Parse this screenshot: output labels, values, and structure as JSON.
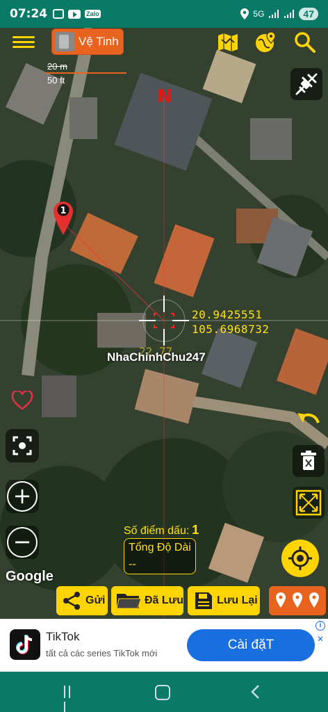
{
  "status_bar": {
    "time": "07:24",
    "zalo": "Zalo",
    "network": "5G",
    "battery": "47"
  },
  "toolbar": {
    "map_type_label": "Vệ Tinh"
  },
  "scale": {
    "meters": "20 m",
    "feet": "50 ft"
  },
  "compass_label": "N",
  "marker_label": "1",
  "coordinates": {
    "lat": "20.9425551",
    "lon": "105.6968732"
  },
  "distance_overlay": "22.77",
  "watermark": "NhaChinhChu247",
  "measure": {
    "count_label": "Số điểm dấu:",
    "count_value": "1",
    "total_label": "Tổng Độ Dài",
    "total_value": "--"
  },
  "google_label": "Google",
  "bottom_tools": {
    "send": "Gửi",
    "saved": "Đã Lưu",
    "save": "Lưu Lại"
  },
  "ad": {
    "title": "TikTok",
    "subtitle": "tất cả các series TikTok mới",
    "cta": "Cài đặT",
    "info": "i",
    "close": "✕"
  },
  "colors": {
    "accent_yellow": "#ffd400",
    "accent_orange": "#e8641e",
    "status_teal": "#0a7a68",
    "ad_blue": "#1a6fe0"
  }
}
